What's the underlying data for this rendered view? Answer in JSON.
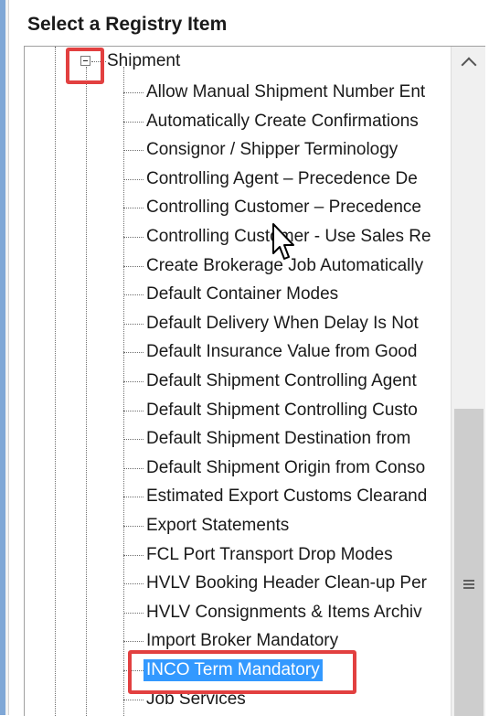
{
  "panel": {
    "header": "Select a Registry Item"
  },
  "tree": {
    "root_label": "Shipment",
    "items": [
      {
        "label": "Allow Manual Shipment Number Ent"
      },
      {
        "label": "Automatically Create Confirmations"
      },
      {
        "label": "Consignor / Shipper Terminology"
      },
      {
        "label": "Controlling Agent – Precedence De"
      },
      {
        "label": "Controlling Customer – Precedence"
      },
      {
        "label": "Controlling Customer - Use Sales Re"
      },
      {
        "label": "Create Brokerage Job Automatically"
      },
      {
        "label": "Default Container Modes"
      },
      {
        "label": "Default Delivery When Delay Is Not"
      },
      {
        "label": "Default Insurance Value from Good"
      },
      {
        "label": "Default Shipment Controlling Agent"
      },
      {
        "label": "Default Shipment Controlling Custo"
      },
      {
        "label": "Default Shipment Destination from"
      },
      {
        "label": "Default Shipment Origin from Conso"
      },
      {
        "label": "Estimated Export Customs Clearand"
      },
      {
        "label": "Export Statements"
      },
      {
        "label": "FCL Port Transport Drop Modes"
      },
      {
        "label": "HVLV Booking Header Clean-up Per"
      },
      {
        "label": "HVLV Consignments & Items Archiv"
      },
      {
        "label": "Import Broker Mandatory"
      },
      {
        "label": "INCO Term Mandatory",
        "selected": true
      },
      {
        "label": "Job Services"
      }
    ]
  },
  "colors": {
    "selection": "#3399ff",
    "annotation": "#e24040",
    "accent_bar": "#7fa7d6"
  },
  "icons": {
    "expander": "collapse-minus-icon",
    "scroll_up": "chevron-up-icon",
    "scroll_grip": "grip-lines-icon",
    "cursor": "mouse-pointer-icon"
  }
}
